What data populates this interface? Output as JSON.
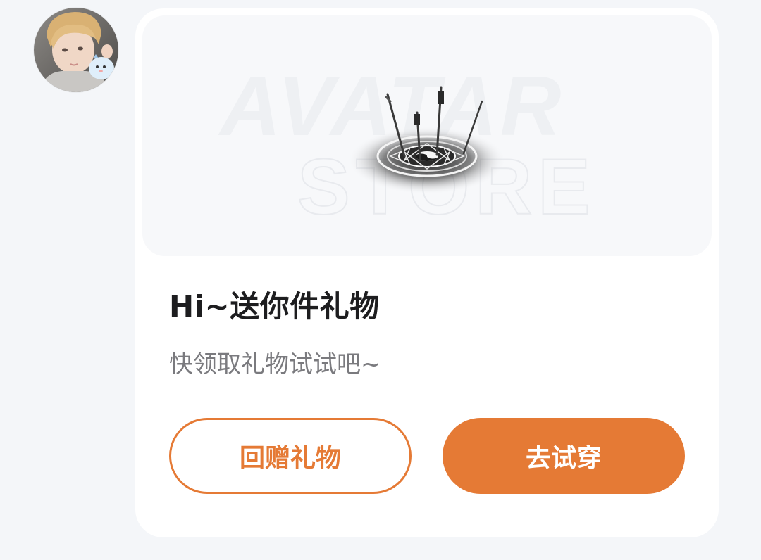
{
  "message": {
    "title": "Hi~送你件礼物",
    "subtitle": "快领取礼物试试吧~",
    "banner": {
      "watermark_line1": "AVATAR",
      "watermark_line2": "STORE",
      "item_icon": "yin-yang-magic-circle-with-swords"
    },
    "buttons": {
      "return_gift_label": "回赠礼物",
      "try_on_label": "去试穿"
    }
  },
  "sender": {
    "avatar_icon": "user-avatar-photo"
  },
  "colors": {
    "accent": "#e57a35",
    "background": "#f4f6f9",
    "card": "#ffffff",
    "title": "#1d1d1f",
    "subtitle": "#7a7a7e"
  }
}
